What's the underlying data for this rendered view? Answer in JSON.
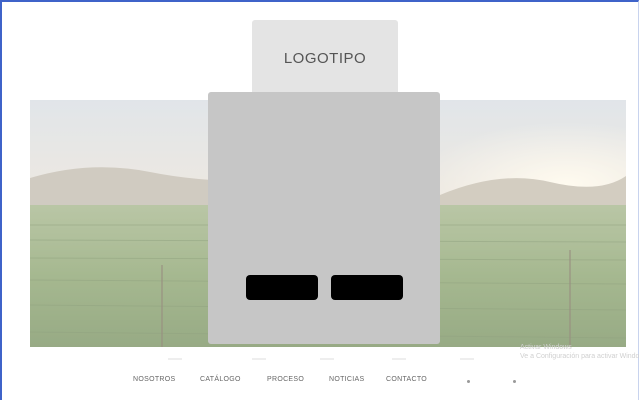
{
  "header": {
    "logo_label": "LOGOTIPO"
  },
  "hero": {
    "image": "vineyard-sunset-photo"
  },
  "modal": {
    "primary_button_label": "",
    "secondary_button_label": ""
  },
  "watermark": {
    "line1": "Activar Windows",
    "line2": "Ve a Configuración para activar Windows."
  },
  "nav": {
    "items": [
      {
        "label": "NOSOTROS"
      },
      {
        "label": "CATÁLOGO"
      },
      {
        "label": "PROCESO"
      },
      {
        "label": "NOTICIAS"
      },
      {
        "label": "CONTACTO"
      }
    ],
    "icons": [
      "dot-icon",
      "dot-icon"
    ]
  },
  "colors": {
    "frame_border": "#3f63c9",
    "logo_bg": "#e4e4e4",
    "modal_bg": "#c6c6c6",
    "button_bg": "#000000"
  }
}
